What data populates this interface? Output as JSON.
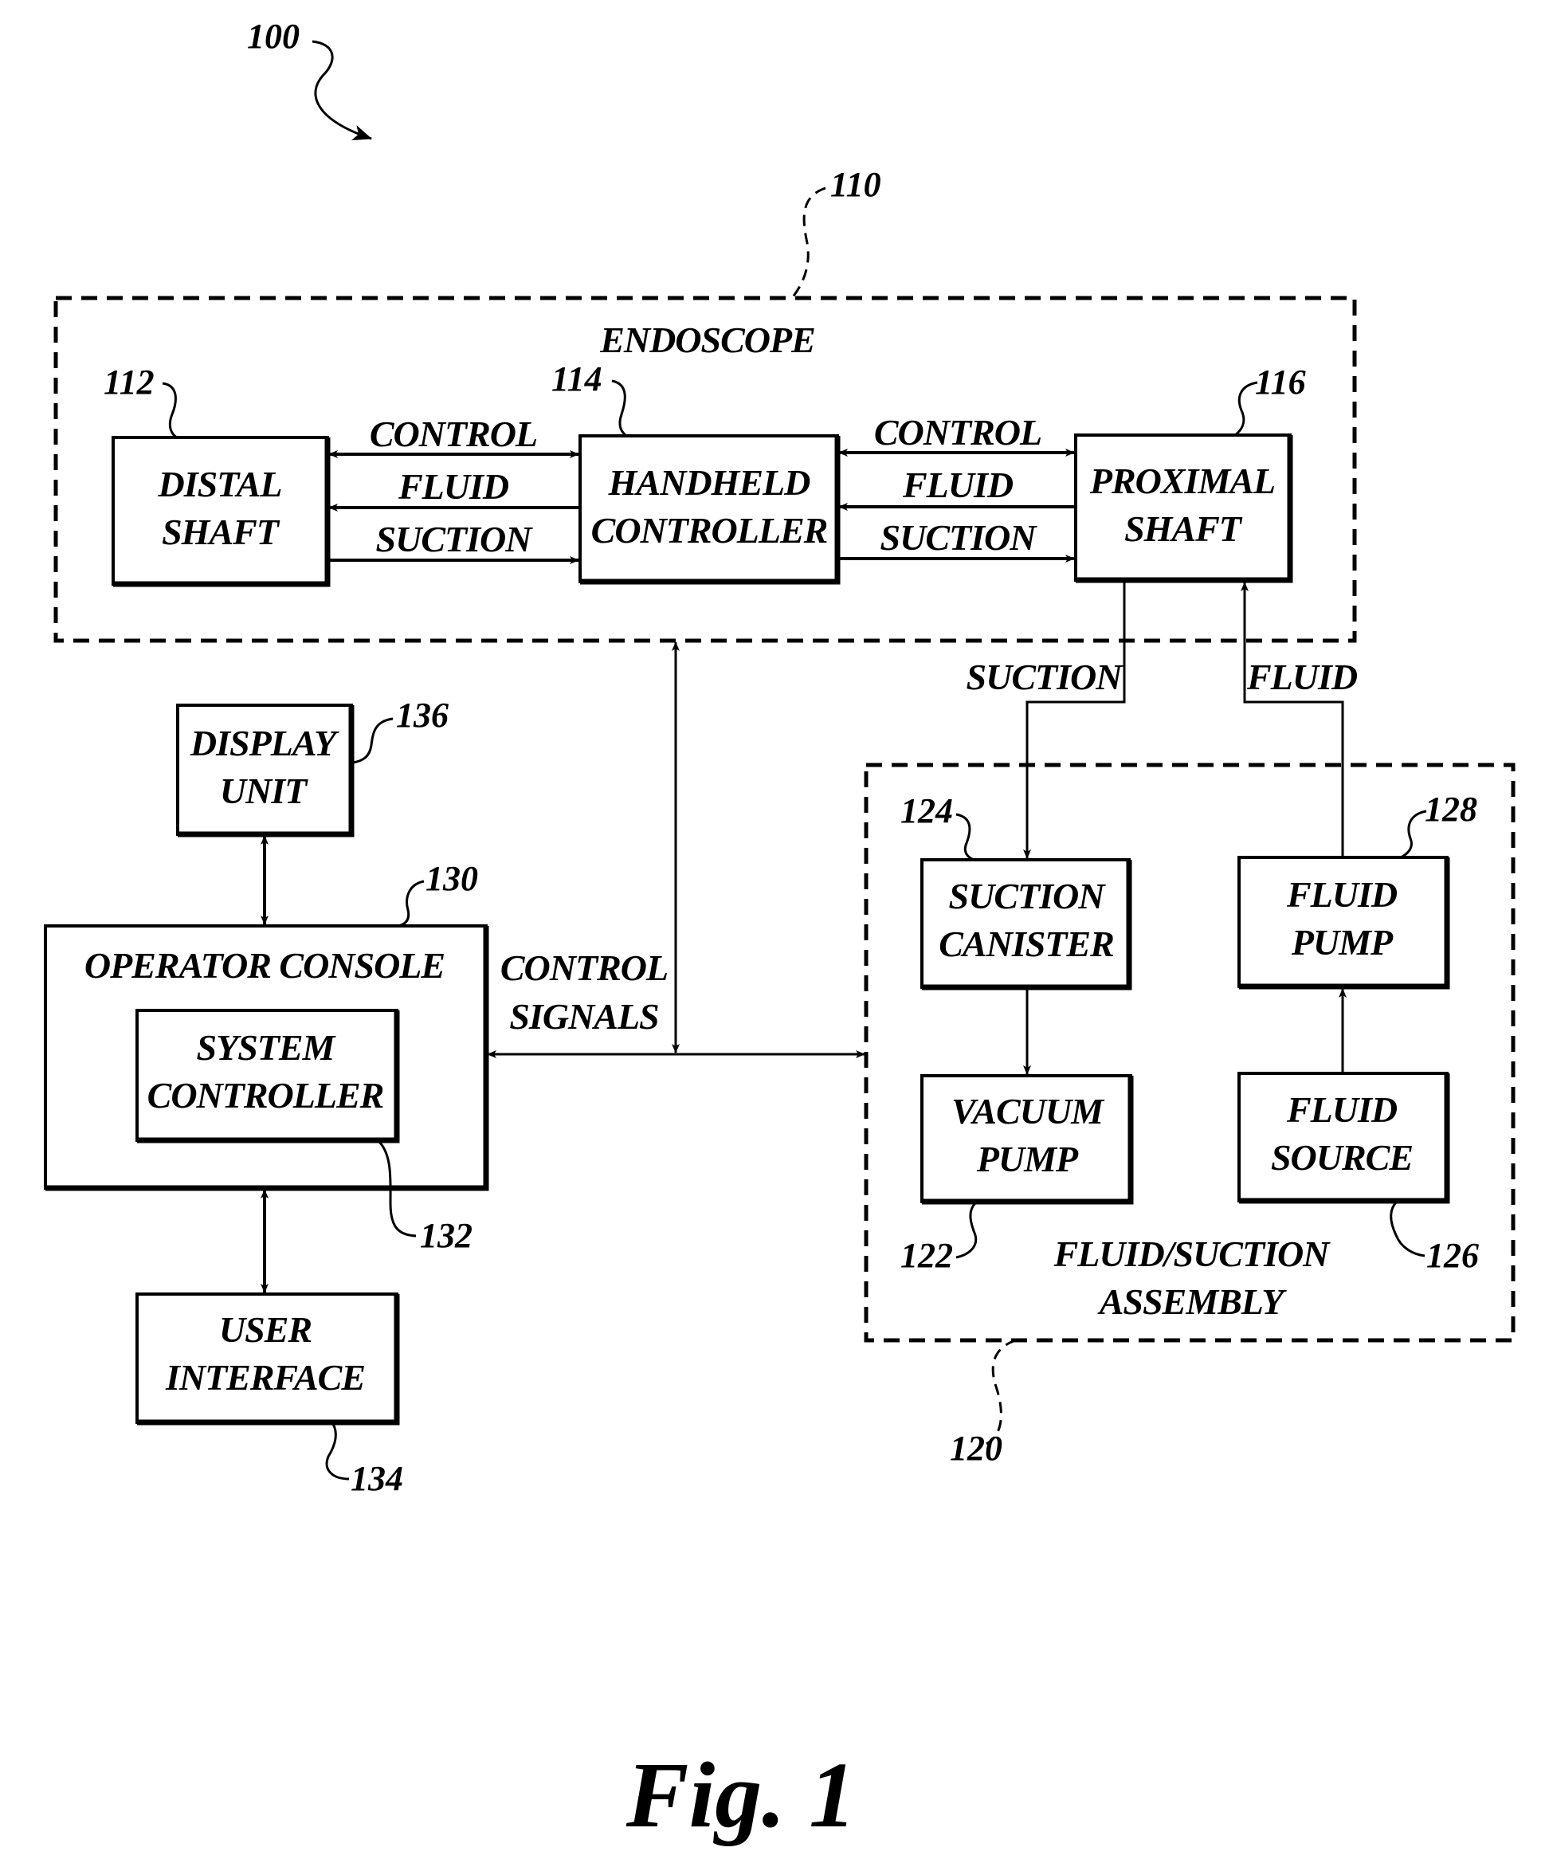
{
  "figure": {
    "caption": "Fig. 1",
    "system_ref": "100"
  },
  "endoscope": {
    "ref": "110",
    "title": "ENDOSCOPE",
    "distal_shaft": {
      "ref": "112",
      "lines": [
        "DISTAL",
        "SHAFT"
      ]
    },
    "handheld_controller": {
      "ref": "114",
      "lines": [
        "HANDHELD",
        "CONTROLLER"
      ]
    },
    "proximal_shaft": {
      "ref": "116",
      "lines": [
        "PROXIMAL",
        "SHAFT"
      ]
    },
    "links_left": [
      "CONTROL",
      "FLUID",
      "SUCTION"
    ],
    "links_right": [
      "CONTROL",
      "FLUID",
      "SUCTION"
    ]
  },
  "fluid_suction_assembly": {
    "ref": "120",
    "title_lines": [
      "FLUID/SUCTION",
      "ASSEMBLY"
    ],
    "vacuum_pump": {
      "ref": "122",
      "lines": [
        "VACUUM",
        "PUMP"
      ]
    },
    "suction_canister": {
      "ref": "124",
      "lines": [
        "SUCTION",
        "CANISTER"
      ]
    },
    "fluid_source": {
      "ref": "126",
      "lines": [
        "FLUID",
        "SOURCE"
      ]
    },
    "fluid_pump": {
      "ref": "128",
      "lines": [
        "FLUID",
        "PUMP"
      ]
    },
    "suction_link": "SUCTION",
    "fluid_link": "FLUID"
  },
  "operator_console": {
    "ref": "130",
    "title": "OPERATOR CONSOLE",
    "system_controller": {
      "ref": "132",
      "lines": [
        "SYSTEM",
        "CONTROLLER"
      ]
    },
    "user_interface": {
      "ref": "134",
      "lines": [
        "USER",
        "INTERFACE"
      ]
    },
    "display_unit": {
      "ref": "136",
      "lines": [
        "DISPLAY",
        "UNIT"
      ]
    }
  },
  "control_signals": {
    "lines": [
      "CONTROL",
      "SIGNALS"
    ]
  }
}
